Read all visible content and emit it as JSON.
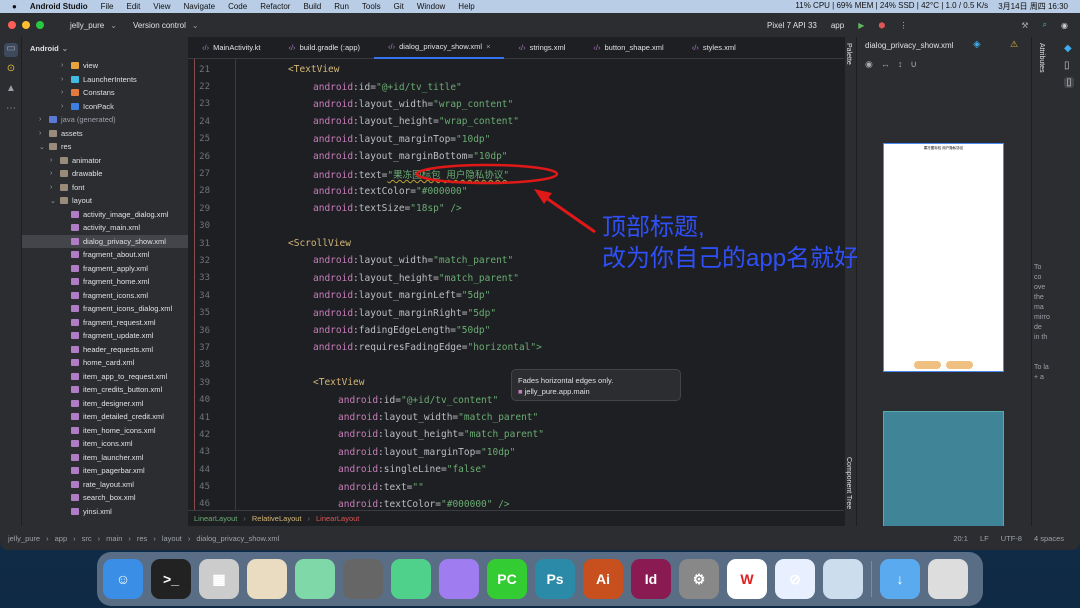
{
  "menubar": {
    "app": "Android Studio",
    "items": [
      "File",
      "Edit",
      "View",
      "Navigate",
      "Code",
      "Refactor",
      "Build",
      "Run",
      "Tools",
      "Git",
      "Window",
      "Help"
    ],
    "stats": "11% CPU | 69% MEM | 24% SSD | 42°C | 1.0 / 0.5 K/s",
    "datetime": "3月14日 周四 16:30"
  },
  "titlebar": {
    "project": "jelly_pure",
    "vcs": "Version control",
    "device": "Pixel 7 API 33",
    "config": "app"
  },
  "project_panel": {
    "title": "Android",
    "items": [
      {
        "label": "view",
        "indent": 3,
        "arrow": ">",
        "color": "#e8a33d"
      },
      {
        "label": "LauncherIntents",
        "indent": 3,
        "arrow": ">",
        "color": "#3ebde0"
      },
      {
        "label": "Constans",
        "indent": 3,
        "arrow": ">",
        "color": "#e07a3e"
      },
      {
        "label": "IconPack",
        "indent": 3,
        "arrow": ">",
        "color": "#3e7ee0"
      },
      {
        "label": "java (generated)",
        "indent": 1,
        "arrow": ">",
        "color": "#5b7ad6"
      },
      {
        "label": "assets",
        "indent": 1,
        "arrow": ">",
        "color": "#9a8a7a"
      },
      {
        "label": "res",
        "indent": 1,
        "arrow": "v",
        "color": "#9a8a7a"
      },
      {
        "label": "animator",
        "indent": 2,
        "arrow": ">",
        "color": "#9a8a7a"
      },
      {
        "label": "drawable",
        "indent": 2,
        "arrow": ">",
        "color": "#9a8a7a"
      },
      {
        "label": "font",
        "indent": 2,
        "arrow": ">",
        "color": "#9a8a7a"
      },
      {
        "label": "layout",
        "indent": 2,
        "arrow": "v",
        "color": "#9a8a7a"
      },
      {
        "label": "activity_image_dialog.xml",
        "indent": 3,
        "arrow": "",
        "color": "#b07cc6"
      },
      {
        "label": "activity_main.xml",
        "indent": 3,
        "arrow": "",
        "color": "#b07cc6"
      },
      {
        "label": "dialog_privacy_show.xml",
        "indent": 3,
        "arrow": "",
        "color": "#b07cc6",
        "selected": true
      },
      {
        "label": "fragment_about.xml",
        "indent": 3,
        "arrow": "",
        "color": "#b07cc6"
      },
      {
        "label": "fragment_apply.xml",
        "indent": 3,
        "arrow": "",
        "color": "#b07cc6"
      },
      {
        "label": "fragment_home.xml",
        "indent": 3,
        "arrow": "",
        "color": "#b07cc6"
      },
      {
        "label": "fragment_icons.xml",
        "indent": 3,
        "arrow": "",
        "color": "#b07cc6"
      },
      {
        "label": "fragment_icons_dialog.xml",
        "indent": 3,
        "arrow": "",
        "color": "#b07cc6"
      },
      {
        "label": "fragment_request.xml",
        "indent": 3,
        "arrow": "",
        "color": "#b07cc6"
      },
      {
        "label": "fragment_update.xml",
        "indent": 3,
        "arrow": "",
        "color": "#b07cc6"
      },
      {
        "label": "header_requests.xml",
        "indent": 3,
        "arrow": "",
        "color": "#b07cc6"
      },
      {
        "label": "home_card.xml",
        "indent": 3,
        "arrow": "",
        "color": "#b07cc6"
      },
      {
        "label": "item_app_to_request.xml",
        "indent": 3,
        "arrow": "",
        "color": "#b07cc6"
      },
      {
        "label": "item_credits_button.xml",
        "indent": 3,
        "arrow": "",
        "color": "#b07cc6"
      },
      {
        "label": "item_designer.xml",
        "indent": 3,
        "arrow": "",
        "color": "#b07cc6"
      },
      {
        "label": "item_detailed_credit.xml",
        "indent": 3,
        "arrow": "",
        "color": "#b07cc6"
      },
      {
        "label": "item_home_icons.xml",
        "indent": 3,
        "arrow": "",
        "color": "#b07cc6"
      },
      {
        "label": "item_icons.xml",
        "indent": 3,
        "arrow": "",
        "color": "#b07cc6"
      },
      {
        "label": "item_launcher.xml",
        "indent": 3,
        "arrow": "",
        "color": "#b07cc6"
      },
      {
        "label": "item_pagerbar.xml",
        "indent": 3,
        "arrow": "",
        "color": "#b07cc6"
      },
      {
        "label": "rate_layout.xml",
        "indent": 3,
        "arrow": "",
        "color": "#b07cc6"
      },
      {
        "label": "search_box.xml",
        "indent": 3,
        "arrow": "",
        "color": "#b07cc6"
      },
      {
        "label": "yinsi.xml",
        "indent": 3,
        "arrow": "",
        "color": "#b07cc6"
      }
    ]
  },
  "tabs": [
    {
      "label": "MainActivity.kt"
    },
    {
      "label": "build.gradle (:app)"
    },
    {
      "label": "dialog_privacy_show.xml",
      "active": true
    },
    {
      "label": "strings.xml"
    },
    {
      "label": "button_shape.xml"
    },
    {
      "label": "styles.xml"
    }
  ],
  "code": [
    {
      "n": "21",
      "i": 1,
      "t": "tag",
      "s": "<TextView"
    },
    {
      "n": "22",
      "i": 2,
      "a": "id",
      "v": "\"@+id/tv_title\""
    },
    {
      "n": "23",
      "i": 2,
      "a": "layout_width",
      "v": "\"wrap_content\""
    },
    {
      "n": "24",
      "i": 2,
      "a": "layout_height",
      "v": "\"wrap_content\""
    },
    {
      "n": "25",
      "i": 2,
      "a": "layout_marginTop",
      "v": "\"10dp\""
    },
    {
      "n": "26",
      "i": 2,
      "a": "layout_marginBottom",
      "v": "\"10dp\""
    },
    {
      "n": "27",
      "i": 2,
      "a": "text",
      "v": "\"果冻图标包 用户隐私协议\"",
      "hl": true
    },
    {
      "n": "28",
      "i": 2,
      "a": "textColor",
      "v": "\"#000000\""
    },
    {
      "n": "29",
      "i": 2,
      "a": "textSize",
      "v": "\"18sp\" />"
    },
    {
      "n": "30",
      "i": 0,
      "t": "tag",
      "s": ""
    },
    {
      "n": "31",
      "i": 1,
      "t": "tag",
      "s": "<ScrollView"
    },
    {
      "n": "32",
      "i": 2,
      "a": "layout_width",
      "v": "\"match_parent\""
    },
    {
      "n": "33",
      "i": 2,
      "a": "layout_height",
      "v": "\"match_parent\""
    },
    {
      "n": "34",
      "i": 2,
      "a": "layout_marginLeft",
      "v": "\"5dp\""
    },
    {
      "n": "35",
      "i": 2,
      "a": "layout_marginRight",
      "v": "\"5dp\""
    },
    {
      "n": "36",
      "i": 2,
      "a": "fadingEdgeLength",
      "v": "\"50dp\""
    },
    {
      "n": "37",
      "i": 2,
      "a": "requiresFadingEdge",
      "v": "\"horizontal\">"
    },
    {
      "n": "38",
      "i": 0,
      "t": "tag",
      "s": ""
    },
    {
      "n": "39",
      "i": 2,
      "t": "tag",
      "s": "<TextView"
    },
    {
      "n": "40",
      "i": 3,
      "a": "id",
      "v": "\"@+id/tv_content\""
    },
    {
      "n": "41",
      "i": 3,
      "a": "layout_width",
      "v": "\"match_parent\""
    },
    {
      "n": "42",
      "i": 3,
      "a": "layout_height",
      "v": "\"match_parent\""
    },
    {
      "n": "43",
      "i": 3,
      "a": "layout_marginTop",
      "v": "\"10dp\""
    },
    {
      "n": "44",
      "i": 3,
      "a": "singleLine",
      "v": "\"false\""
    },
    {
      "n": "45",
      "i": 3,
      "a": "text",
      "v": "\"\""
    },
    {
      "n": "46",
      "i": 3,
      "a": "textColor",
      "v": "\"#000000\" />"
    }
  ],
  "editor_breadcrumb": [
    "LinearLayout",
    "RelativeLayout",
    "LinearLayout"
  ],
  "tooltip": {
    "text": "Fades horizontal edges only.",
    "module": "jelly_pure.app.main"
  },
  "annotation": {
    "line1": "顶部标题,",
    "line2": "改为你自己的app名就好"
  },
  "design": {
    "file": "dialog_privacy_show.xml",
    "palette": "Palette",
    "attributes": "Attributes",
    "component_tree": "Component Tree",
    "hint_lines": [
      "To",
      "co",
      "ove",
      "the",
      "ma",
      "mirro",
      "de",
      "in th",
      "To la",
      "+ a"
    ],
    "preview_title": "果冻图标包 用户隐私协议"
  },
  "status": {
    "path": [
      "jelly_pure",
      "app",
      "src",
      "main",
      "res",
      "layout",
      "dialog_privacy_show.xml"
    ],
    "position": "20:1",
    "line_sep": "LF",
    "encoding": "UTF-8",
    "indent": "4 spaces"
  },
  "dock": [
    {
      "name": "finder",
      "c": "#3a8ee6",
      "t": "☺"
    },
    {
      "name": "terminal",
      "c": "#222",
      "t": ">_"
    },
    {
      "name": "launchpad",
      "c": "#ccc",
      "t": "▦"
    },
    {
      "name": "qq",
      "c": "#e9dcc0",
      "t": ""
    },
    {
      "name": "app-cartoon",
      "c": "#7fd8a8",
      "t": ""
    },
    {
      "name": "app-bird",
      "c": "#666",
      "t": ""
    },
    {
      "name": "android-studio",
      "c": "#4fd18b",
      "t": ""
    },
    {
      "name": "app-planet",
      "c": "#9f7df0",
      "t": ""
    },
    {
      "name": "pycharm",
      "c": "#3c3",
      "t": "PC"
    },
    {
      "name": "photoshop",
      "c": "#2b8aa8",
      "t": "Ps"
    },
    {
      "name": "illustrator",
      "c": "#c8501e",
      "t": "Ai"
    },
    {
      "name": "indesign",
      "c": "#8a1b52",
      "t": "Id"
    },
    {
      "name": "system-settings",
      "c": "#888",
      "t": "⚙"
    },
    {
      "name": "wps",
      "c": "#fff",
      "t": "W"
    },
    {
      "name": "safari",
      "c": "#e8f0ff",
      "t": "⊘"
    },
    {
      "name": "preview",
      "c": "#cde",
      "t": ""
    },
    {
      "name": "downloads",
      "c": "#5aaaf0",
      "t": "↓"
    },
    {
      "name": "trash",
      "c": "#ddd",
      "t": ""
    }
  ]
}
